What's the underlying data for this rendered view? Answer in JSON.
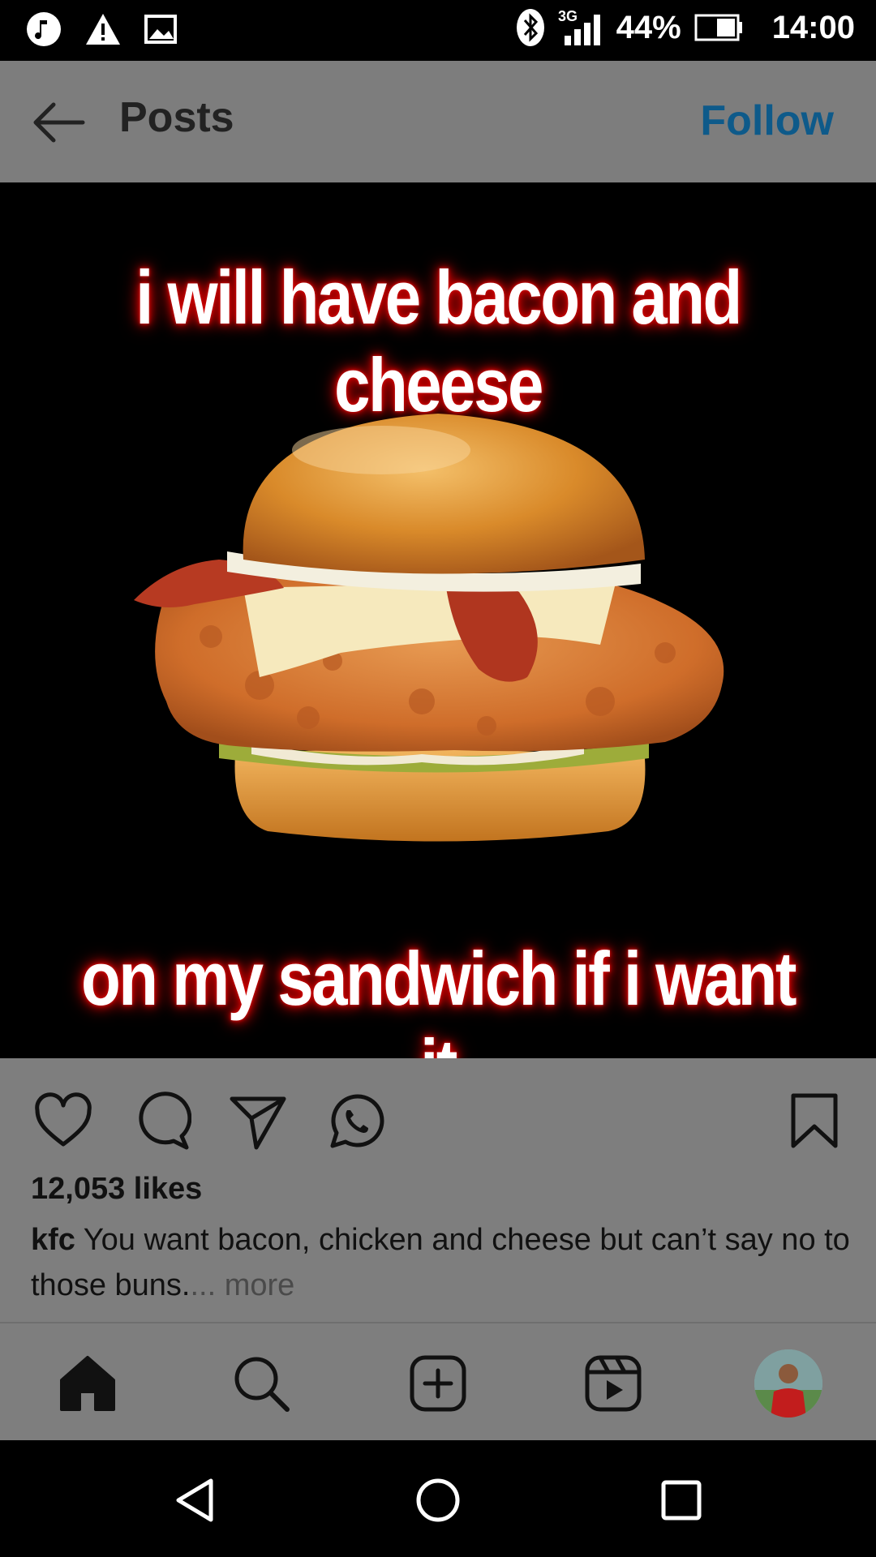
{
  "status_bar": {
    "network": "3G",
    "battery": "44%",
    "time": "14:00",
    "icons": [
      "music-note-icon",
      "warning-icon",
      "image-icon",
      "bluetooth-icon",
      "signal-icon",
      "battery-icon"
    ]
  },
  "header": {
    "title": "Posts",
    "follow_label": "Follow",
    "accent_color": "#0e5a8a"
  },
  "post": {
    "meme_top": "i will have bacon and cheese",
    "meme_bottom": "on my sandwich if i want it",
    "likes": "12,053 likes",
    "caption_user": "kfc",
    "caption_text": " You want bacon, chicken and cheese but can’t say no to those buns.",
    "caption_more": "... more"
  },
  "actions": [
    "heart-icon",
    "comment-icon",
    "share-icon",
    "whatsapp-icon",
    "bookmark-icon"
  ],
  "bottom_nav": [
    "home-icon",
    "search-icon",
    "add-post-icon",
    "reels-icon",
    "profile-avatar"
  ],
  "system_nav": [
    "back-icon",
    "home-circle-icon",
    "recents-icon"
  ]
}
